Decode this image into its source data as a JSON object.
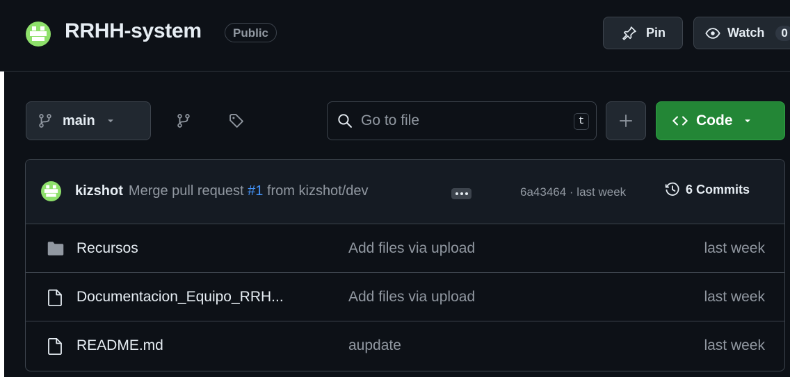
{
  "repo": {
    "name": "RRHH-system",
    "visibility": "Public",
    "avatar_icon": "identicon-avatar"
  },
  "header_actions": {
    "pin_label": "Pin",
    "watch_label": "Watch",
    "watch_count": "0"
  },
  "toolbar": {
    "branch_name": "main",
    "branches_icon": "git-branch-icon",
    "tags_icon": "tag-icon",
    "search_placeholder": "Go to file",
    "search_shortcut": "t",
    "add_file_icon": "plus-icon",
    "code_label": "Code"
  },
  "latest_commit": {
    "author": "kizshot",
    "message_prefix": "Merge pull request",
    "pr_ref": "#1",
    "message_suffix": "from kizshot/dev",
    "hash_and_time": "6a43464 · last week",
    "commits_label": "6 Commits"
  },
  "files": [
    {
      "type": "folder",
      "name": "Recursos",
      "commit": "Add files via upload",
      "date": "last week"
    },
    {
      "type": "file",
      "name": "Documentacion_Equipo_RRH...",
      "commit": "Add files via upload",
      "date": "last week"
    },
    {
      "type": "file",
      "name": "README.md",
      "commit": "aupdate",
      "date": "last week"
    }
  ],
  "colors": {
    "background": "#0d1117",
    "accent_green": "#238636",
    "link_blue": "#4493f8",
    "muted_text": "#9198a1",
    "avatar_green": "#8ee06b"
  }
}
